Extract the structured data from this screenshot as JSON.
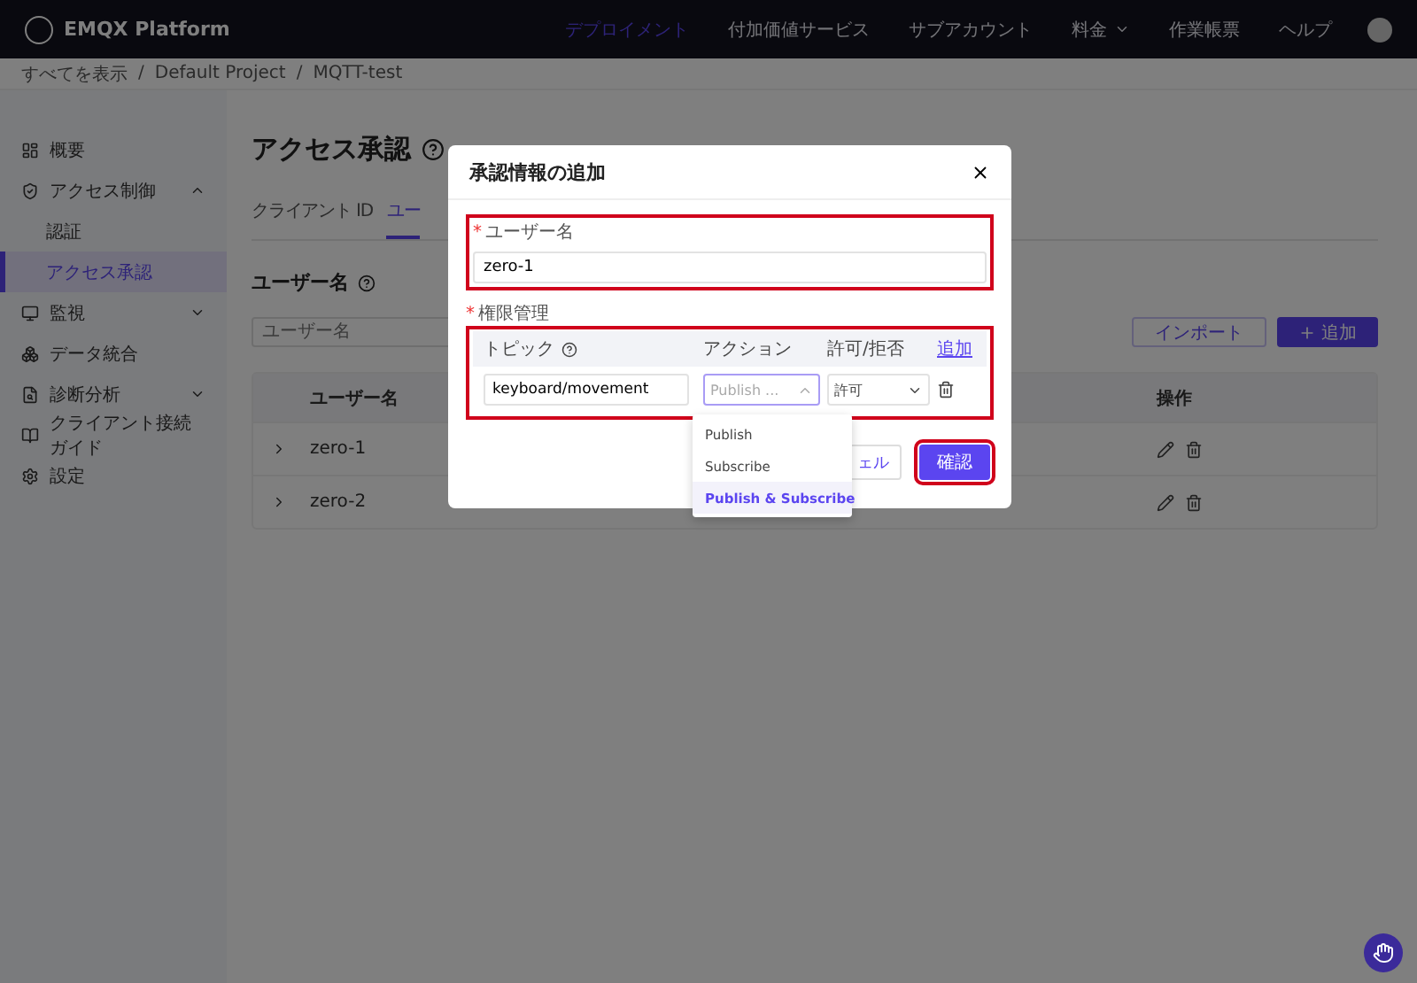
{
  "topbar": {
    "brand": "EMQX Platform",
    "nav": [
      {
        "label": "デプロイメント",
        "selected": true,
        "caret": false
      },
      {
        "label": "付加価値サービス",
        "selected": false,
        "caret": false
      },
      {
        "label": "サブアカウント",
        "selected": false,
        "caret": false
      },
      {
        "label": "料金",
        "selected": false,
        "caret": true
      },
      {
        "label": "作業帳票",
        "selected": false,
        "caret": false
      },
      {
        "label": "ヘルプ",
        "selected": false,
        "caret": false
      }
    ]
  },
  "breadcrumb": {
    "separator": "/",
    "items": [
      "すべてを表示",
      "Default Project",
      "MQTT-test"
    ]
  },
  "sidebar": {
    "items": [
      {
        "label": "概要",
        "selected": false
      },
      {
        "label": "アクセス制御",
        "selected": false,
        "expanded": true,
        "children": [
          {
            "label": "認証",
            "selected": false
          },
          {
            "label": "アクセス承認",
            "selected": true
          }
        ]
      },
      {
        "label": "監視",
        "selected": false,
        "expanded": false
      },
      {
        "label": "データ統合",
        "selected": false
      },
      {
        "label": "診断分析",
        "selected": false,
        "expanded": false
      },
      {
        "label": "クライアント接続ガイド",
        "selected": false
      },
      {
        "label": "設定",
        "selected": false
      }
    ]
  },
  "page": {
    "title": "アクセス承認",
    "tabs": [
      {
        "label": "クライアント ID",
        "selected": false
      },
      {
        "label": "ユー",
        "selected": true
      }
    ],
    "section_title": "ユーザー名",
    "search": {
      "placeholder": "ユーザー名"
    },
    "buttons": [
      {
        "label": "インポート",
        "kind": "outline"
      },
      {
        "label": "追加",
        "kind": "primary"
      }
    ],
    "table": {
      "columns": [
        "ユーザー名",
        "操作"
      ],
      "rows": [
        {
          "username": "zero-1"
        },
        {
          "username": "zero-2"
        }
      ]
    }
  },
  "modal": {
    "title": "承認情報の追加",
    "username": {
      "label": "ユーザー名",
      "value": "zero-1",
      "required_mark": "*",
      "highlighted": true
    },
    "permissions": {
      "label": "権限管理",
      "required_mark": "*",
      "highlighted": true,
      "columns": [
        "トピック",
        "アクション",
        "許可/拒否"
      ],
      "add_link": "追加",
      "rows": [
        {
          "topic": "keyboard/movement",
          "action": "Publish ...",
          "action_open": true,
          "permission": "許可"
        }
      ]
    },
    "dropdown": [
      {
        "label": "Publish",
        "selected": false
      },
      {
        "label": "Subscribe",
        "selected": false
      },
      {
        "label": "Publish & Subscribe",
        "selected": true
      }
    ],
    "cancel": {
      "label": "ェル"
    },
    "confirm": {
      "label": "確認",
      "highlighted": true
    }
  }
}
